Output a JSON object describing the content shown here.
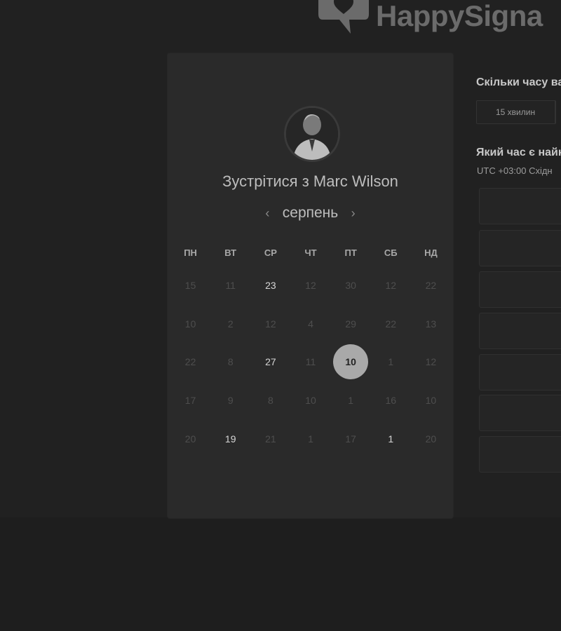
{
  "brand": {
    "name": "HappySigna"
  },
  "calendar": {
    "title": "Зустрітися з Marc Wilson",
    "month": "серпень",
    "prev_icon": "chevron-left-icon",
    "next_icon": "chevron-right-icon",
    "weekdays": [
      "ПН",
      "ВТ",
      "СР",
      "ЧТ",
      "ПТ",
      "СБ",
      "НД"
    ],
    "weeks": [
      [
        {
          "d": "15",
          "s": "off"
        },
        {
          "d": "11",
          "s": "off"
        },
        {
          "d": "23",
          "s": "active"
        },
        {
          "d": "12",
          "s": "off"
        },
        {
          "d": "30",
          "s": "off"
        },
        {
          "d": "12",
          "s": "off"
        },
        {
          "d": "22",
          "s": "off"
        }
      ],
      [
        {
          "d": "10",
          "s": "off"
        },
        {
          "d": "2",
          "s": "off"
        },
        {
          "d": "12",
          "s": "off"
        },
        {
          "d": "4",
          "s": "off"
        },
        {
          "d": "29",
          "s": "off"
        },
        {
          "d": "22",
          "s": "off"
        },
        {
          "d": "13",
          "s": "off"
        }
      ],
      [
        {
          "d": "22",
          "s": "off"
        },
        {
          "d": "8",
          "s": "off"
        },
        {
          "d": "27",
          "s": "active"
        },
        {
          "d": "11",
          "s": "off"
        },
        {
          "d": "10",
          "s": "selected"
        },
        {
          "d": "1",
          "s": "off"
        },
        {
          "d": "12",
          "s": "off"
        }
      ],
      [
        {
          "d": "17",
          "s": "off"
        },
        {
          "d": "9",
          "s": "off"
        },
        {
          "d": "8",
          "s": "off"
        },
        {
          "d": "10",
          "s": "off"
        },
        {
          "d": "1",
          "s": "off"
        },
        {
          "d": "16",
          "s": "off"
        },
        {
          "d": "10",
          "s": "off"
        }
      ],
      [
        {
          "d": "20",
          "s": "off"
        },
        {
          "d": "19",
          "s": "active"
        },
        {
          "d": "21",
          "s": "off"
        },
        {
          "d": "1",
          "s": "off"
        },
        {
          "d": "17",
          "s": "off"
        },
        {
          "d": "1",
          "s": "active"
        },
        {
          "d": "20",
          "s": "off"
        }
      ]
    ]
  },
  "scheduling": {
    "duration_question": "Скільки часу ва",
    "duration_value": "15 хвилин",
    "time_question": "Який час є найк",
    "timezone": "UTC +03:00 Східн",
    "slot_count": 7
  },
  "colors": {
    "background": "#212121",
    "card": "#2a2a2a",
    "selected_day": "#a9a9a9"
  }
}
